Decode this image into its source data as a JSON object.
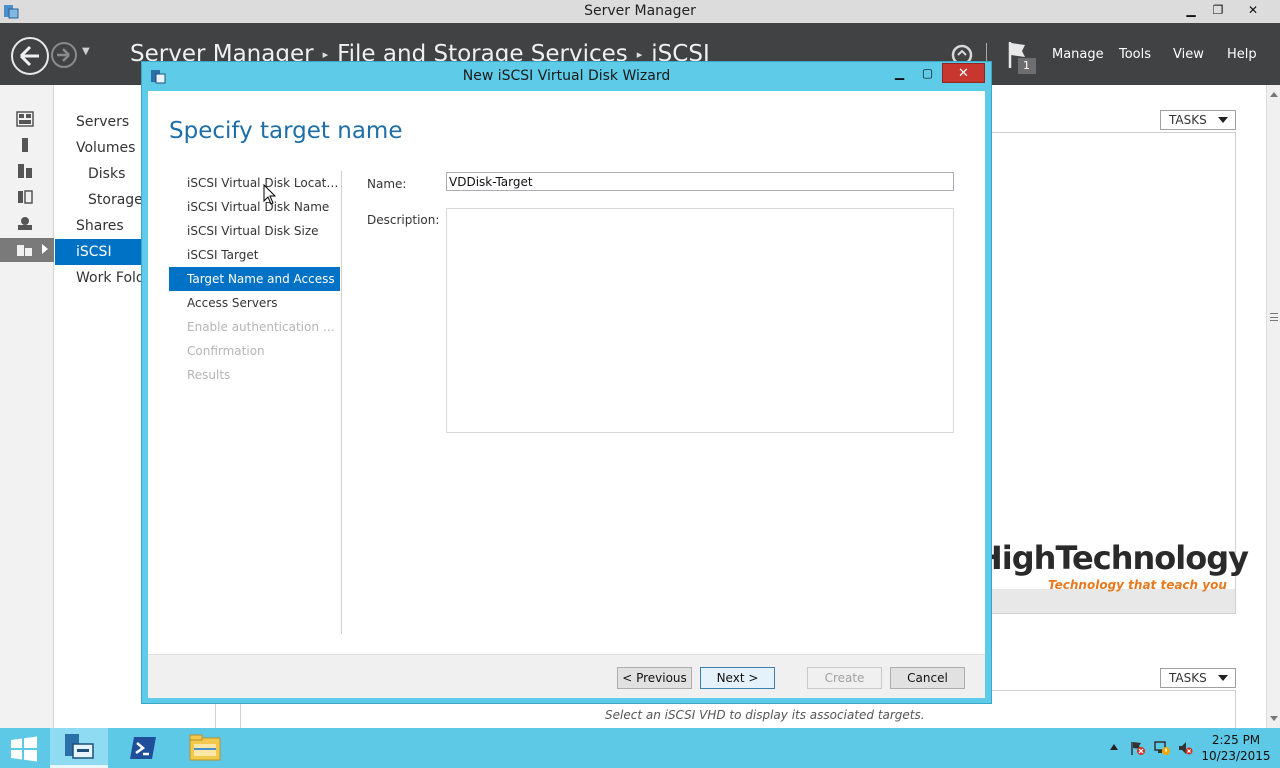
{
  "window": {
    "title": "Server Manager",
    "min_label": "▁",
    "restore_label": "❐",
    "close_label": "✕"
  },
  "header": {
    "breadcrumb": [
      "Server Manager",
      "File and Storage Services",
      "iSCSI"
    ],
    "breadcrumb_sep": "▸",
    "nav_dropdown": "▼",
    "notification_count": "1",
    "menu": [
      "Manage",
      "Tools",
      "View",
      "Help"
    ]
  },
  "nav": {
    "items": [
      {
        "label": "Servers"
      },
      {
        "label": "Volumes"
      },
      {
        "label": "Disks"
      },
      {
        "label": "Storage Pools"
      },
      {
        "label": "Shares"
      },
      {
        "label": "iSCSI"
      },
      {
        "label": "Work Folders"
      }
    ]
  },
  "tasks_label": "TASKS",
  "bottom_message": "Select an iSCSI VHD to display its associated targets.",
  "wizard": {
    "title": "New iSCSI Virtual Disk Wizard",
    "heading": "Specify target name",
    "min_label": "▁",
    "max_label": "▢",
    "close_label": "✕",
    "steps": [
      {
        "label": "iSCSI Virtual Disk Location",
        "state": "normal"
      },
      {
        "label": "iSCSI Virtual Disk Name",
        "state": "normal"
      },
      {
        "label": "iSCSI Virtual Disk Size",
        "state": "normal"
      },
      {
        "label": "iSCSI Target",
        "state": "normal"
      },
      {
        "label": "Target Name and Access",
        "state": "selected"
      },
      {
        "label": "Access Servers",
        "state": "normal"
      },
      {
        "label": "Enable authentication service",
        "state": "disabled"
      },
      {
        "label": "Confirmation",
        "state": "disabled"
      },
      {
        "label": "Results",
        "state": "disabled"
      }
    ],
    "name_label": "Name:",
    "name_value": "VDDisk-Target",
    "description_label": "Description:",
    "description_value": "",
    "buttons": {
      "previous": "< Previous",
      "next": "Next >",
      "create": "Create",
      "cancel": "Cancel"
    }
  },
  "watermark": {
    "title": "HighTechnology",
    "tagline": "Technology that teach you"
  },
  "taskbar": {
    "time": "2:25 PM",
    "date": "10/23/2015"
  },
  "colors": {
    "accent": "#0072c6",
    "header_bg": "#404244",
    "dialog_frame": "#5ecbe8",
    "taskbar": "#5dc9e6",
    "heading": "#1e6ea7"
  },
  "icons": [
    "server-manager-icon",
    "back-arrow-icon",
    "forward-arrow-icon",
    "refresh-icon",
    "flag-icon",
    "dashboard-icon",
    "local-server-icon",
    "all-servers-icon",
    "file-services-icon",
    "windows-start-icon",
    "powershell-icon",
    "file-explorer-icon",
    "network-icon",
    "speaker-icon",
    "action-center-icon"
  ]
}
